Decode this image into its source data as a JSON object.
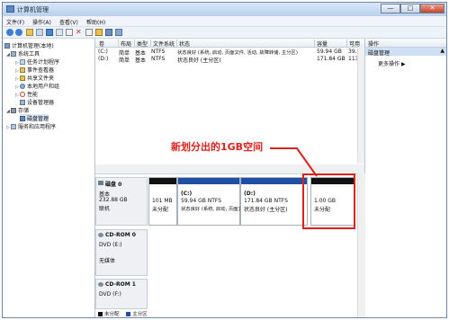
{
  "window": {
    "title": "计算机管理",
    "min": "—",
    "max": "□",
    "close": "✕"
  },
  "menu": [
    "文件(F)",
    "操作(A)",
    "查看(V)",
    "帮助(H)"
  ],
  "tree": {
    "root": "计算机管理(本地)",
    "system_tools": "系统工具",
    "task_scheduler": "任务计划程序",
    "event_viewer": "事件查看器",
    "shared_folders": "共享文件夹",
    "local_users": "本地用户和组",
    "performance": "性能",
    "device_manager": "设备管理器",
    "storage": "存储",
    "disk_management": "磁盘管理",
    "services": "服务和应用程序"
  },
  "volume_list": {
    "headers": [
      "卷",
      "布局",
      "类型",
      "文件系统",
      "状态",
      "容量",
      "可用"
    ],
    "rows": [
      [
        "(C:)",
        "简单",
        "基本",
        "NTFS",
        "状态良好 (系统, 启动, 页面文件, 活动, 故障转储, 主分区)",
        "59.94 GB",
        "39.8"
      ],
      [
        "(D:)",
        "简单",
        "基本",
        "NTFS",
        "状态良好 (主分区)",
        "171.84 GB",
        "113."
      ]
    ]
  },
  "actions": {
    "header": "操作",
    "selected": "磁盘管理",
    "more": "更多操作"
  },
  "disks": [
    {
      "name": "磁盘 0",
      "type": "基本",
      "size": "232.88 GB",
      "status": "联机"
    },
    {
      "name": "CD-ROM 0",
      "type": "DVD (E:)",
      "size": "",
      "status": "无媒体"
    },
    {
      "name": "CD-ROM 1",
      "type": "DVD (F:)",
      "size": "",
      "status": ""
    }
  ],
  "partitions": [
    {
      "label": "",
      "size": "101 MB",
      "status": "未分配"
    },
    {
      "label": "(C:)",
      "size": "59.94 GB NTFS",
      "status": "状态良好 (系统, 启动, 页面文件"
    },
    {
      "label": "(D:)",
      "size": "171.84 GB NTFS",
      "status": "状态良好 (主分区)"
    },
    {
      "label": "",
      "size": "1.00 GB",
      "status": "未分配"
    }
  ],
  "legend": {
    "unallocated": "未分配",
    "primary": "主分区"
  },
  "annotation": "新划分出的1GB空间",
  "colors": {
    "accent": "#e0201a",
    "primary_bar": "#1e4fa3",
    "unalloc_bar": "#111111"
  }
}
